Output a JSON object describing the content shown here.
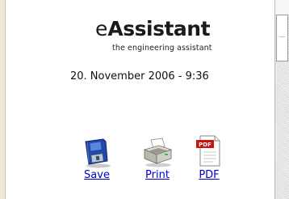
{
  "logo": {
    "prefix": "e",
    "word": "Assistant",
    "tagline": "the engineering assistant"
  },
  "timestamp": "20. November 2006 - 9:36",
  "actions": [
    {
      "label": "Save",
      "icon": "floppy-disk-icon"
    },
    {
      "label": "Print",
      "icon": "printer-icon"
    },
    {
      "label": "PDF",
      "icon": "pdf-document-icon"
    }
  ],
  "colors": {
    "link": "#0000cc",
    "pdf_red": "#cc1111",
    "floppy_blue": "#2448a8"
  }
}
